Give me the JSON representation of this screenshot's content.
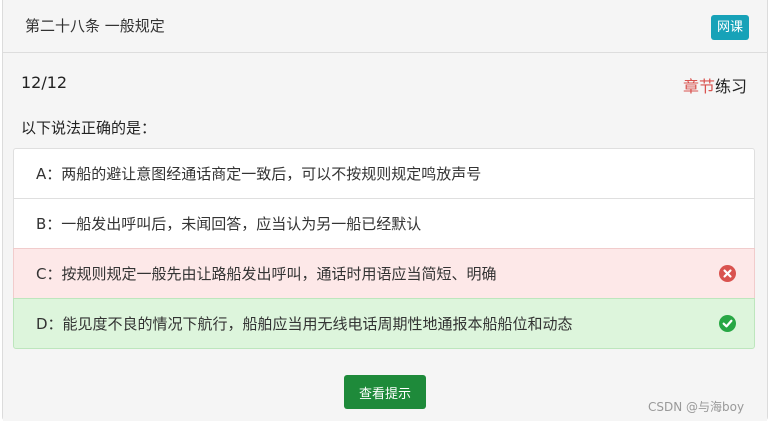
{
  "header": {
    "title": "第二十八条 一般规定",
    "badge": "网课"
  },
  "quiz": {
    "progress": "12/12",
    "mode_highlight": "章节",
    "mode_rest": "练习",
    "question": "以下说法正确的是：",
    "options": [
      {
        "label": "A：两船的避让意图经通话商定一致后，可以不按规则规定鸣放声号",
        "state": "neutral"
      },
      {
        "label": "B：一船发出呼叫后，未闻回答，应当认为另一船已经默认",
        "state": "neutral"
      },
      {
        "label": "C：按规则规定一般先由让路船发出呼叫，通话时用语应当简短、明确",
        "state": "wrong",
        "icon": "x-circle-icon"
      },
      {
        "label": "D：能见度不良的情况下航行，船舶应当用无线电话周期性地通报本船船位和动态",
        "state": "correct",
        "icon": "check-circle-icon"
      }
    ],
    "hint_button": "查看提示"
  },
  "footer": {
    "watermark": "CSDN @与海boy"
  },
  "colors": {
    "badge": "#17a2b8",
    "wrong_bg": "#fde8e8",
    "correct_bg": "#ddf5dc",
    "wrong_icon": "#d9534f",
    "correct_icon": "#28a745",
    "hint_button": "#1e8a3a",
    "mode_highlight": "#d9534f"
  }
}
